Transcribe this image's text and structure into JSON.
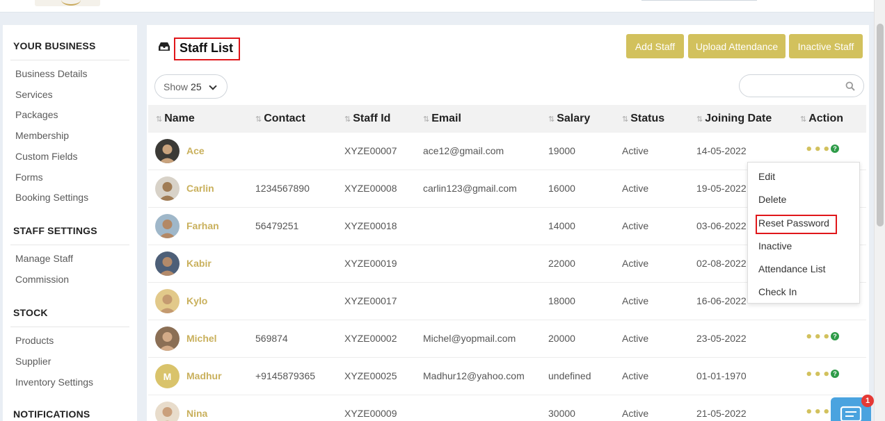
{
  "sidebar": {
    "sections": [
      {
        "title": "YOUR BUSINESS",
        "items": [
          "Business Details",
          "Services",
          "Packages",
          "Membership",
          "Custom Fields",
          "Forms",
          "Booking Settings"
        ]
      },
      {
        "title": "STAFF SETTINGS",
        "items": [
          "Manage Staff",
          "Commission"
        ]
      },
      {
        "title": "STOCK",
        "items": [
          "Products",
          "Supplier",
          "Inventory Settings"
        ]
      },
      {
        "title": "NOTIFICATIONS",
        "items": []
      }
    ]
  },
  "page": {
    "title": "Staff List",
    "buttons": {
      "add_staff": "Add Staff",
      "upload_attendance": "Upload Attendance",
      "inactive_staff": "Inactive Staff"
    },
    "show": {
      "label": "Show",
      "value": "25"
    },
    "search": {
      "placeholder": ""
    }
  },
  "table": {
    "headers": {
      "name": "Name",
      "contact": "Contact",
      "staff_id": "Staff Id",
      "email": "Email",
      "salary": "Salary",
      "status": "Status",
      "joining_date": "Joining Date",
      "action": "Action"
    },
    "rows": [
      {
        "name": "Ace",
        "contact": "",
        "staff_id": "XYZE00007",
        "email": "ace12@gmail.com",
        "salary": "19000",
        "status": "Active",
        "joining_date": "14-05-2022",
        "avatar": "photo"
      },
      {
        "name": "Carlin",
        "contact": "1234567890",
        "staff_id": "XYZE00008",
        "email": "carlin123@gmail.com",
        "salary": "16000",
        "status": "Active",
        "joining_date": "19-05-2022",
        "avatar": "photo"
      },
      {
        "name": "Farhan",
        "contact": "56479251",
        "staff_id": "XYZE00018",
        "email": "",
        "salary": "14000",
        "status": "Active",
        "joining_date": "03-06-2022",
        "avatar": "photo"
      },
      {
        "name": "Kabir",
        "contact": "",
        "staff_id": "XYZE00019",
        "email": "",
        "salary": "22000",
        "status": "Active",
        "joining_date": "02-08-2022",
        "avatar": "photo"
      },
      {
        "name": "Kylo",
        "contact": "",
        "staff_id": "XYZE00017",
        "email": "",
        "salary": "18000",
        "status": "Active",
        "joining_date": "16-06-2022",
        "avatar": "photo"
      },
      {
        "name": "Michel",
        "contact": "569874",
        "staff_id": "XYZE00002",
        "email": "Michel@yopmail.com",
        "salary": "20000",
        "status": "Active",
        "joining_date": "23-05-2022",
        "avatar": "photo"
      },
      {
        "name": "Madhur",
        "contact": "+9145879365",
        "staff_id": "XYZE00025",
        "email": "Madhur12@yahoo.com",
        "salary": "undefined",
        "status": "Active",
        "joining_date": "01-01-1970",
        "avatar": "initial",
        "initial": "M"
      },
      {
        "name": "Nina",
        "contact": "",
        "staff_id": "XYZE00009",
        "email": "",
        "salary": "30000",
        "status": "Active",
        "joining_date": "21-05-2022",
        "avatar": "photo"
      }
    ]
  },
  "action_menu": {
    "items": [
      "Edit",
      "Delete",
      "Reset Password",
      "Inactive",
      "Attendance List",
      "Check In"
    ],
    "highlighted": "Reset Password"
  },
  "chat": {
    "badge": "1"
  },
  "colors": {
    "accent": "#d2c15d",
    "name_link": "#c9b05c",
    "highlight": "#e0161a",
    "help": "#2e9b48",
    "chat": "#4aa3df",
    "badge": "#e53935"
  }
}
